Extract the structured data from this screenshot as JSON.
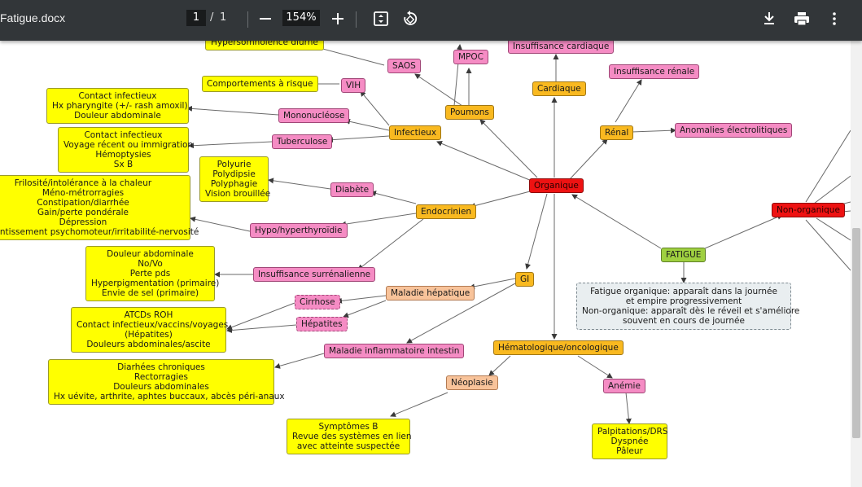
{
  "toolbar": {
    "title": "Fatigue.docx",
    "page_current": "1",
    "page_separator": "/",
    "page_total": "1",
    "zoom": "154%",
    "icons": [
      "zoom-out-icon",
      "zoom-in-icon",
      "fit-page-icon",
      "rotate-icon",
      "download-icon",
      "print-icon",
      "more-vert-icon"
    ]
  },
  "map": {
    "hypersomnolence": "Hypersomnolence diurne",
    "saos": "SAOS",
    "mpoc": "MPOC",
    "ins_cardiaque": "Insuffisance cardiaque",
    "cardiaque": "Cardiaque",
    "ins_renale": "Insuffisance rénale",
    "comportements": "Comportements à risque",
    "vih": "VIH",
    "mono_box": [
      "Contact infectieux",
      "Hx pharyngite (+/- rash amoxil)",
      "Douleur abdominale"
    ],
    "mononucleose": "Mononucléose",
    "poumons": "Poumons",
    "infectieux": "Infectieux",
    "renal": "Rénal",
    "anomalies": "Anomalies électrolitiques",
    "tb_box": [
      "Contact infectieux",
      "Voyage récent ou immigration",
      "Hémoptysies",
      "Sx B"
    ],
    "tuberculose": "Tuberculose",
    "diabete_box": [
      "Polyurie",
      "Polydipsie",
      "Polyphagie",
      "Vision brouillée"
    ],
    "diabete": "Diabète",
    "organique": "Organique",
    "non_organique": "Non-organique",
    "thyroid_box": [
      "Frilosité/intolérance à la chaleur",
      "Méno-métrorragies",
      "Constipation/diarrhée",
      "Gain/perte pondérale",
      "Dépression",
      "Ralentissement psychomoteur/irritabilité-nervosité"
    ],
    "endocrinien": "Endocrinien",
    "hypo_hyper": "Hypo/hyperthyroïdie",
    "fatigue": "FATIGUE",
    "surrenal_box": [
      "Douleur abdominale",
      "No/Vo",
      "Perte pds",
      "Hyperpigmentation (primaire)",
      "Envie de sel (primaire)"
    ],
    "ins_surrenal": "Insuffisance surrénalienne",
    "gi": "GI",
    "fatigue_note": [
      "Fatigue organique: apparaît dans la journée",
      "et empire progressivement",
      "Non-organique: apparaît dès le réveil et s'améliore",
      "souvent en cours de journée"
    ],
    "maladie_hep": "Maladie hépatique",
    "cirrhose": "Cirrhose",
    "hepatites": "Hépatites",
    "hep_box": [
      "ATCDs ROH",
      "Contact infectieux/vaccins/voyages",
      "(Hépatites)",
      "Douleurs abdominales/ascite"
    ],
    "mii": "Maladie inflammatoire intestin",
    "hemato": "Hématologique/oncologique",
    "mii_box": [
      "Diarhées chroniques",
      "Rectorragies",
      "Douleurs abdominales",
      "Hx uévite, arthrite, aphtes buccaux, abcès péri-anaux"
    ],
    "neoplasie": "Néoplasie",
    "anemie": "Anémie",
    "neo_box": [
      "Symptômes B",
      "Revue des systèmes en lien",
      "avec atteinte suspectée"
    ],
    "anemie_box": [
      "Palpitations/DRS",
      "Dyspnée",
      "Pâleur"
    ]
  }
}
